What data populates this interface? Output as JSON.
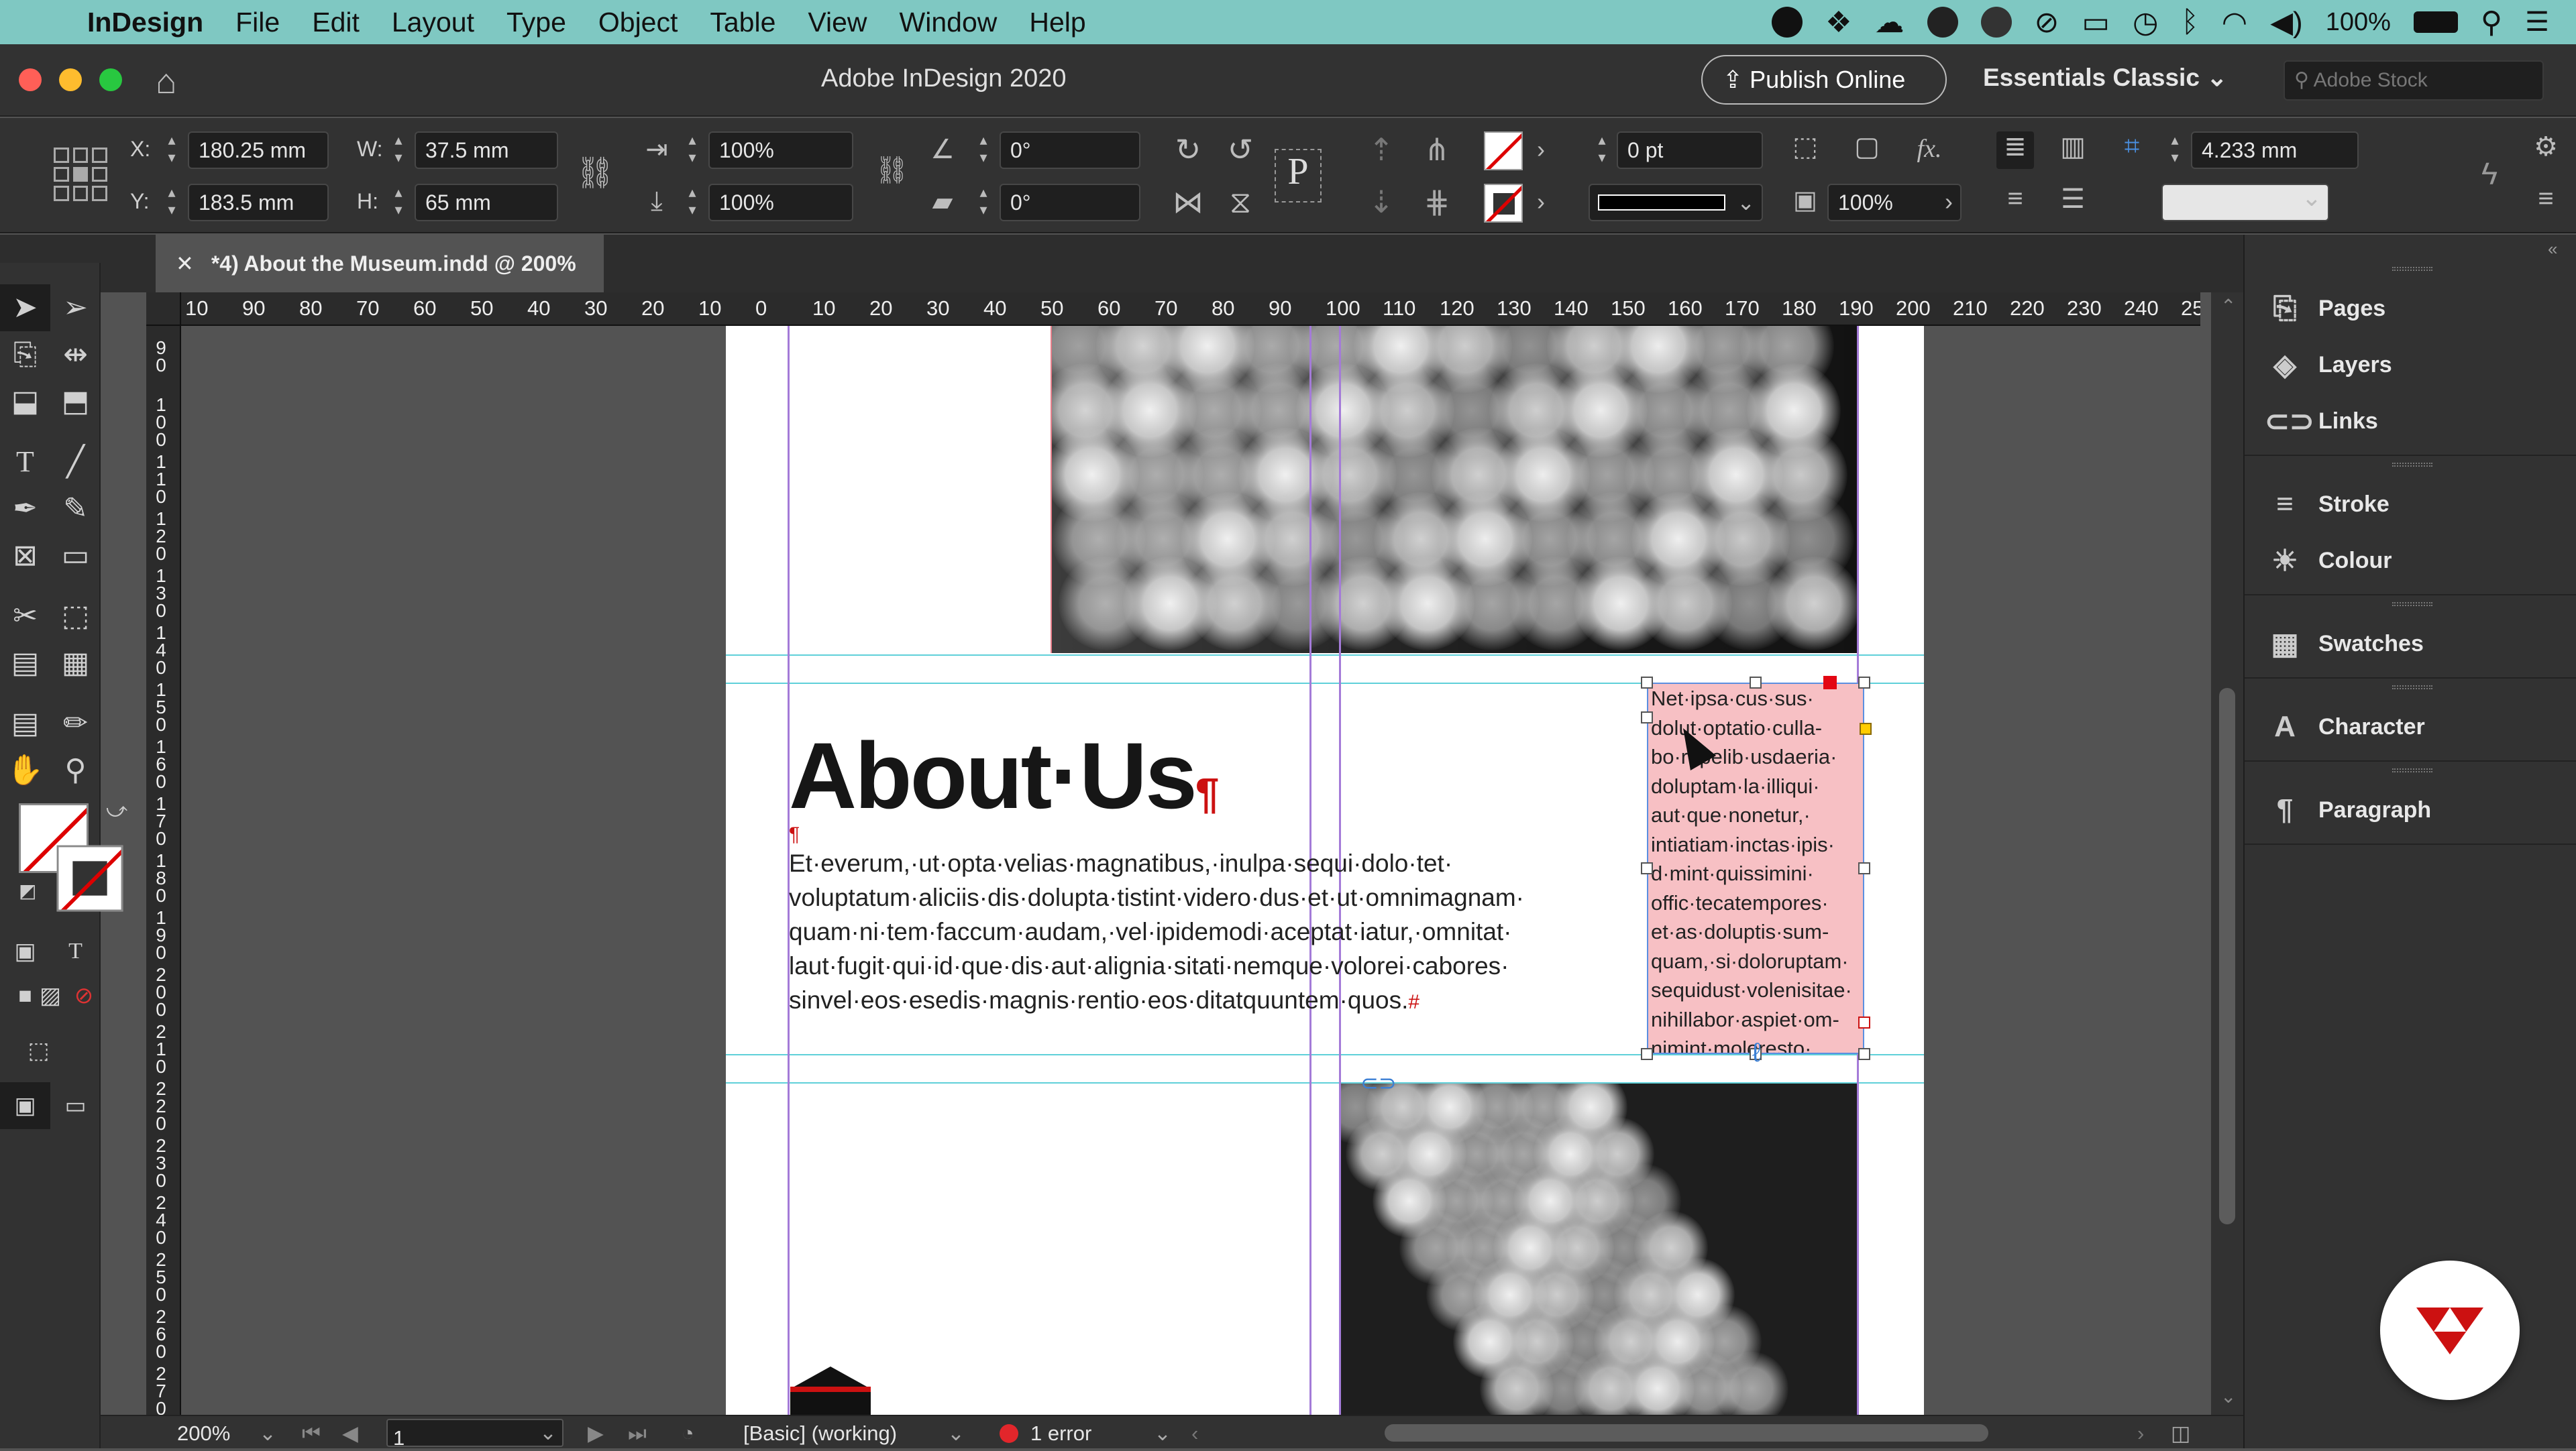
{
  "menubar": {
    "app_name": "InDesign",
    "items": [
      "File",
      "Edit",
      "Layout",
      "Type",
      "Object",
      "Table",
      "View",
      "Window",
      "Help"
    ],
    "battery": "100%"
  },
  "titlebar": {
    "title": "Adobe InDesign 2020",
    "publish_label": "Publish Online",
    "workspace": "Essentials Classic",
    "stock_placeholder": "Adobe Stock"
  },
  "control": {
    "x_label": "X:",
    "x": "180.25 mm",
    "y_label": "Y:",
    "y": "183.5 mm",
    "w_label": "W:",
    "w": "37.5 mm",
    "h_label": "H:",
    "h": "65 mm",
    "scale_x": "100%",
    "scale_y": "100%",
    "rotate": "0°",
    "shear": "0°",
    "stroke_weight": "0 pt",
    "opacity": "100%",
    "gutter": "4.233 mm",
    "fx_label": "fx."
  },
  "document_tab": "*4) About the Museum.indd @ 200%",
  "ruler": {
    "h_ticks": [
      "10",
      "90",
      "80",
      "70",
      "60",
      "50",
      "40",
      "30",
      "20",
      "10",
      "0",
      "10",
      "20",
      "30",
      "40",
      "50",
      "60",
      "70",
      "80",
      "90",
      "100",
      "110",
      "120",
      "130",
      "140",
      "150",
      "160",
      "170",
      "180",
      "190",
      "200",
      "210",
      "220",
      "230",
      "240",
      "250"
    ],
    "v_ticks": [
      "90",
      "100",
      "110",
      "120",
      "130",
      "140",
      "150",
      "160",
      "170",
      "180",
      "190",
      "200",
      "210",
      "220",
      "230",
      "240",
      "250",
      "260",
      "270"
    ]
  },
  "document": {
    "headline": "About·Us",
    "pilcrow": "¶",
    "body": "Et·everum,·ut·opta·velias·magnatibus,·inulpa·sequi·dolo·tet· voluptatum·aliciis·dis·dolupta·tistint·videro·dus·et·ut·omnimagnam· quam·ni·tem·faccum·audam,·vel·ipidemodi·aceptat·iatur,·omnitat· laut·fugit·qui·id·que·dis·aut·alignia·sitati·nemque·volorei·cabores· sinvel·eos·esedis·magnis·rentio·eos·ditatquuntem·quos.",
    "end_mark": "#",
    "sidebar_lines": [
      "Net·ipsa·cus·sus·",
      "dolut·optatio·culla-",
      "bo·repelib·usdaeria·",
      "doluptam·la·illiqui·",
      "aut·que·nonetur,·",
      "intiatiam·inctas·ipis·",
      "d·mint·quissimini·",
      "offic·tecatempores·",
      "et·as·doluptis·sum-",
      "quam,·si·doloruptam·",
      "sequidust·volenisitae·",
      "nihillabor·aspiet·om-",
      "nimint·moloresto·"
    ]
  },
  "panels": {
    "group1": [
      "Pages",
      "Layers",
      "Links"
    ],
    "group2": [
      "Stroke",
      "Colour"
    ],
    "group3": [
      "Swatches"
    ],
    "group4": [
      "Character"
    ],
    "group5": [
      "Paragraph"
    ]
  },
  "status": {
    "zoom": "200%",
    "page": "1",
    "preflight_profile": "[Basic] (working)",
    "errors": "1 error"
  },
  "colors": {
    "menubar_bg": "#7fc8c2",
    "ui_dark": "#323232",
    "pasteboard": "#535353",
    "accent_red": "#cc1111",
    "guide_cyan": "#5fd0d9",
    "overset_pink": "#f7c0c4"
  }
}
